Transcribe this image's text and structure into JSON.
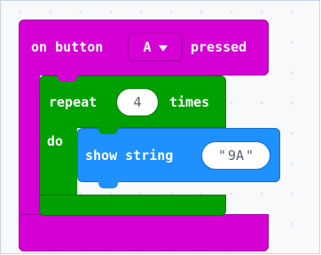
{
  "event_block": {
    "prefix": "on button",
    "button_value": "A",
    "suffix": "pressed"
  },
  "repeat_block": {
    "label": "repeat",
    "count": "4",
    "times_label": "times",
    "do_label": "do"
  },
  "show_string_block": {
    "label": "show string",
    "value": "9A",
    "quote_open": "\"",
    "quote_close": "\""
  },
  "colors": {
    "event_block": "#d400d4",
    "loop_block": "#00a000",
    "basic_block": "#1e90ff",
    "workspace_background": "#f7f9fb"
  },
  "icons": {
    "dropdown": "caret-down-icon"
  }
}
